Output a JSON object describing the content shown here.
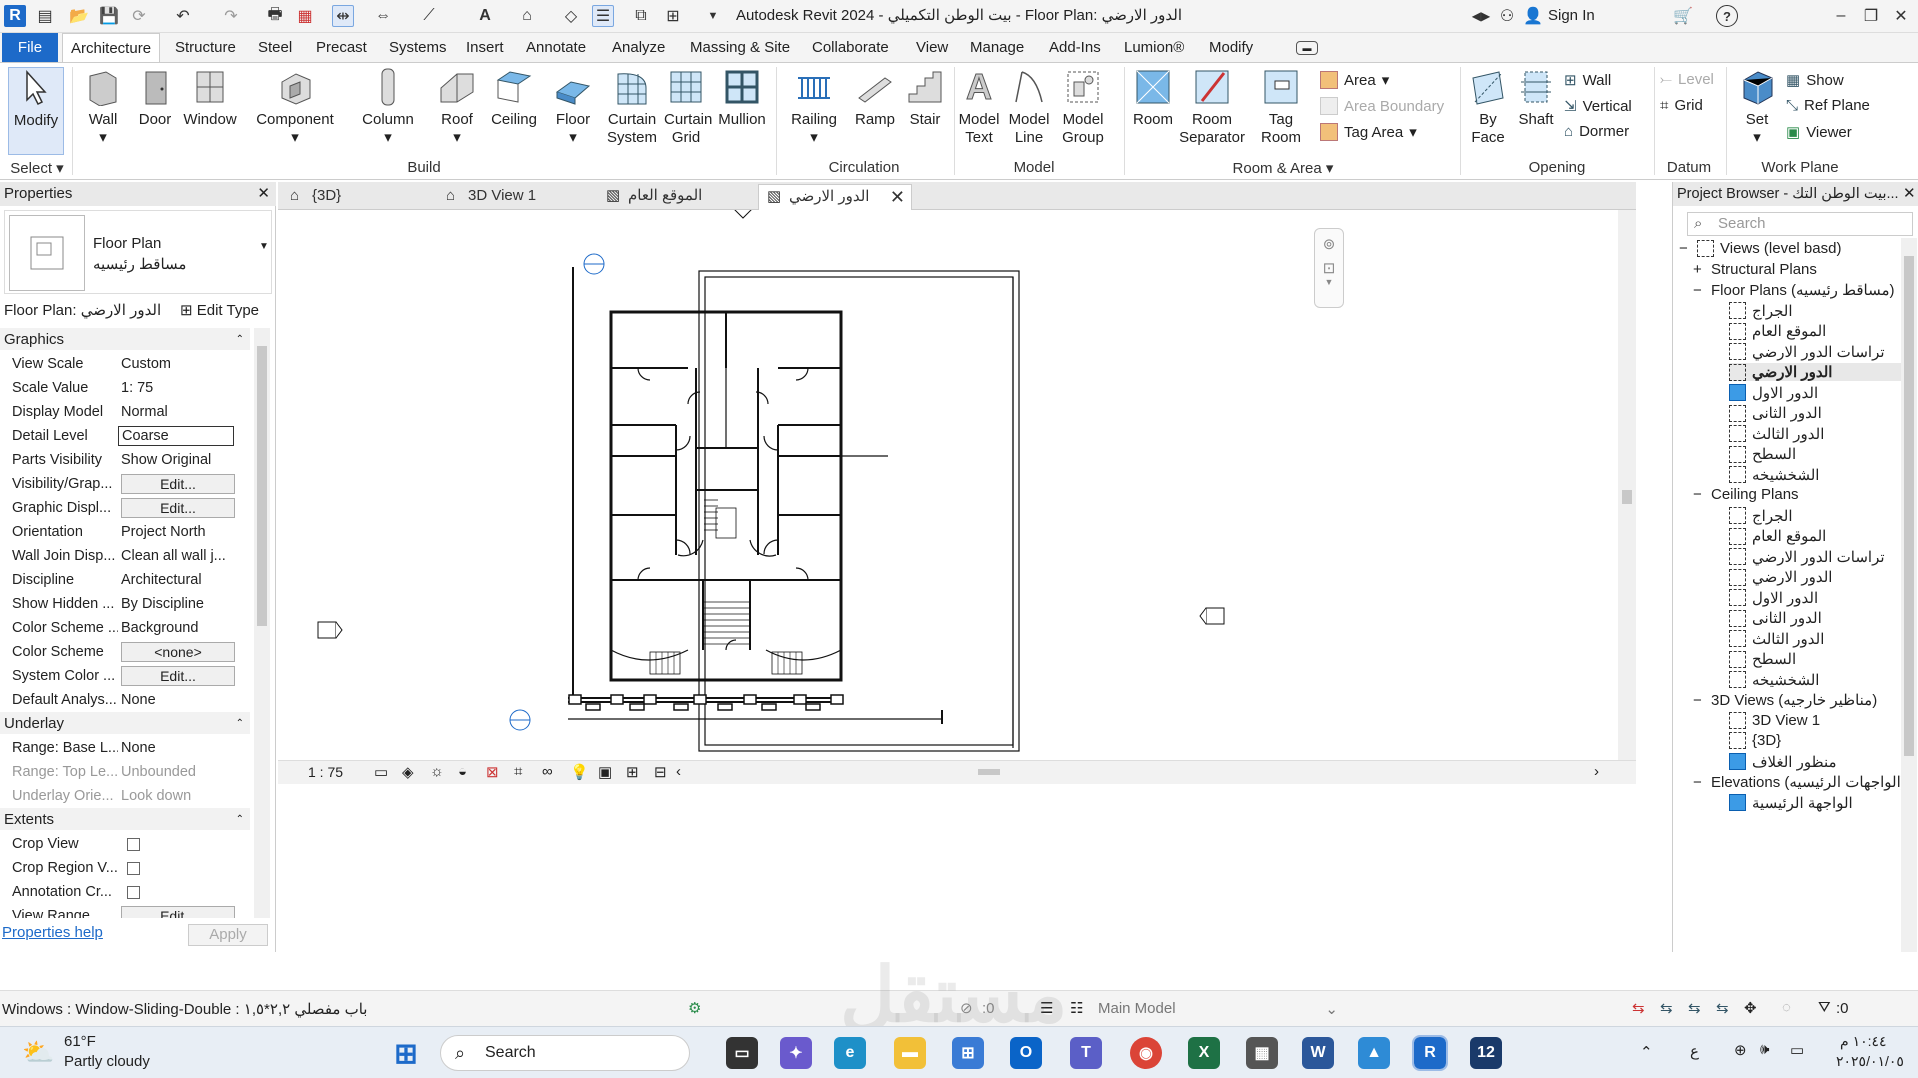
{
  "window": {
    "title": "Autodesk Revit 2024 - بيت الوطن التكميلي - Floor Plan: الدور الارضي",
    "sign_in": "Sign In",
    "app_badge": "R"
  },
  "menu_tabs": [
    "File",
    "Architecture",
    "Structure",
    "Steel",
    "Precast",
    "Systems",
    "Insert",
    "Annotate",
    "Analyze",
    "Massing & Site",
    "Collaborate",
    "View",
    "Manage",
    "Add-Ins",
    "Lumion®",
    "Modify"
  ],
  "ribbon": {
    "select": {
      "modify": "Modify",
      "group": "Select"
    },
    "build": {
      "wall": "Wall",
      "door": "Door",
      "window": "Window",
      "component": "Component",
      "column": "Column",
      "roof": "Roof",
      "ceiling": "Ceiling",
      "floor": "Floor",
      "curtain_system": "Curtain System",
      "curtain_grid": "Curtain Grid",
      "mullion": "Mullion",
      "group": "Build"
    },
    "circulation": {
      "railing": "Railing",
      "ramp": "Ramp",
      "stair": "Stair",
      "group": "Circulation"
    },
    "model": {
      "model_text": "Model Text",
      "model_line": "Model Line",
      "model_group": "Model Group",
      "group": "Model"
    },
    "room_area": {
      "room": "Room",
      "room_separator": "Room Separator",
      "tag_room": "Tag Room",
      "area": "Area",
      "area_boundary": "Area Boundary",
      "tag_area": "Tag Area",
      "group": "Room & Area"
    },
    "opening": {
      "by_face": "By Face",
      "shaft": "Shaft",
      "wall": "Wall",
      "vertical": "Vertical",
      "dormer": "Dormer",
      "group": "Opening"
    },
    "datum": {
      "level": "Level",
      "grid": "Grid",
      "group": "Datum"
    },
    "work_plane": {
      "set": "Set",
      "show": "Show",
      "ref_plane": "Ref Plane",
      "viewer": "Viewer",
      "group": "Work Plane"
    }
  },
  "properties": {
    "title": "Properties",
    "type_name": "Floor Plan",
    "type_sub": "مساقط رئيسيه",
    "instance": "Floor Plan: الدور الارضي",
    "edit_type": "Edit Type",
    "sections": {
      "graphics": "Graphics",
      "underlay": "Underlay",
      "extents": "Extents"
    },
    "graphics_rows": [
      {
        "k": "View Scale",
        "v": "Custom"
      },
      {
        "k": "Scale Value",
        "v": "1:  75"
      },
      {
        "k": "Display Model",
        "v": "Normal"
      },
      {
        "k": "Detail Level",
        "v": "Coarse"
      },
      {
        "k": "Parts Visibility",
        "v": "Show Original"
      },
      {
        "k": "Visibility/Grap...",
        "v": "Edit..."
      },
      {
        "k": "Graphic Displ...",
        "v": "Edit..."
      },
      {
        "k": "Orientation",
        "v": "Project North"
      },
      {
        "k": "Wall Join Disp...",
        "v": "Clean all wall j..."
      },
      {
        "k": "Discipline",
        "v": "Architectural"
      },
      {
        "k": "Show Hidden ...",
        "v": "By Discipline"
      },
      {
        "k": "Color Scheme ...",
        "v": "Background"
      },
      {
        "k": "Color Scheme",
        "v": "<none>"
      },
      {
        "k": "System Color ...",
        "v": "Edit..."
      },
      {
        "k": "Default Analys...",
        "v": "None"
      }
    ],
    "underlay_rows": [
      {
        "k": "Range: Base L...",
        "v": "None"
      },
      {
        "k": "Range: Top Le...",
        "v": "Unbounded"
      },
      {
        "k": "Underlay Orie...",
        "v": "Look down"
      }
    ],
    "extents_rows": [
      {
        "k": "Crop View",
        "v": ""
      },
      {
        "k": "Crop Region V...",
        "v": ""
      },
      {
        "k": "Annotation Cr...",
        "v": ""
      },
      {
        "k": "View Range",
        "v": "Edit..."
      }
    ],
    "help": "Properties help",
    "apply": "Apply"
  },
  "view_tabs": [
    "{3D}",
    "3D View 1",
    "الموقع العام",
    "الدور الارضي"
  ],
  "view_scale": "1 : 75",
  "browser": {
    "title": "Project Browser - بيت الوطن التك...",
    "search_placeholder": "Search",
    "root": "Views (level basd)",
    "structural": "Structural Plans",
    "floor_plans": "Floor Plans (مساقط رئيسيه)",
    "floor_items": [
      "الجراج",
      "الموقع العام",
      "تراسات الدور الارضي",
      "الدور الارضي",
      "الدور الاول",
      "الدور الثانى",
      "الدور الثالث",
      "السطح",
      "الشخشيخه"
    ],
    "ceiling_plans": "Ceiling Plans",
    "ceiling_items": [
      "الجراج",
      "الموقع العام",
      "تراسات الدور الارضي",
      "الدور الارضي",
      "الدور الاول",
      "الدور الثانى",
      "الدور الثالث",
      "السطح",
      "الشخشيخه"
    ],
    "views_3d": "3D Views (مناظير خارجيه)",
    "items_3d": [
      "3D View 1",
      "{3D}",
      "منظور الغلاف"
    ],
    "elevations": "Elevations (الواجهات الرئيسيه)",
    "elev_items": [
      "الواجهة الرئيسية"
    ]
  },
  "status": {
    "text": "Windows : Window-Sliding-Double : باب مفصلي ٢,٢*١,٥",
    "main_model": "Main Model",
    "zero1": ":0",
    "filter_count": ":0"
  },
  "taskbar": {
    "temp": "61°F",
    "weather": "Partly cloudy",
    "search": "Search",
    "time": "١٠:٤٤ م",
    "date": "٢٠٢٥/٠١/٠٥",
    "lang": "ع"
  },
  "watermark": "مستقل",
  "accent": "#1d6ac9"
}
